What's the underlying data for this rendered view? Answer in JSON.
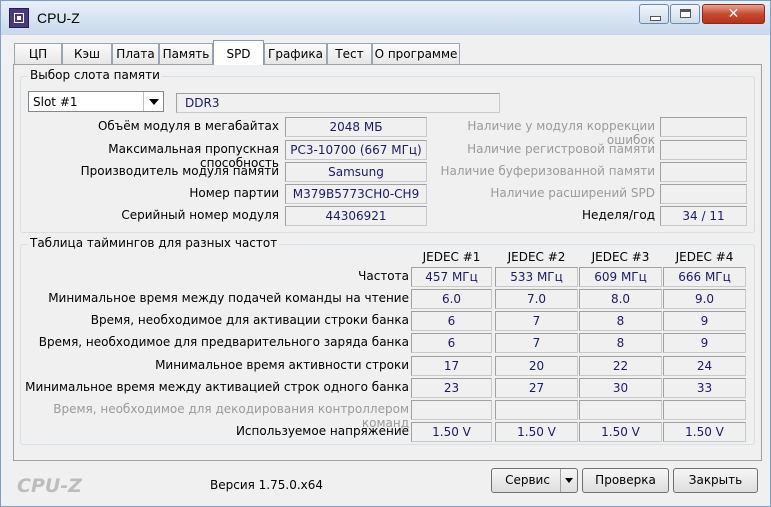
{
  "window": {
    "title": "CPU-Z"
  },
  "tabs": [
    "ЦП",
    "Кэш",
    "Плата",
    "Память",
    "SPD",
    "Графика",
    "Тест",
    "О программе"
  ],
  "active_tab": "SPD",
  "slot_group": {
    "legend": "Выбор слота памяти",
    "slot_selected": "Slot #1",
    "memory_type": "DDR3",
    "rows": [
      {
        "label": "Объём модуля в мегабайтах",
        "value": "2048 МБ"
      },
      {
        "label": "Максимальная пропускная способность",
        "value": "PC3-10700 (667 МГц)"
      },
      {
        "label": "Производитель модуля памяти",
        "value": "Samsung"
      },
      {
        "label": "Номер партии",
        "value": "M379B5773CH0-CH9"
      },
      {
        "label": "Серийный номер модуля",
        "value": "44306921"
      }
    ],
    "right_rows": [
      {
        "label": "Наличие у модуля коррекции ошибок",
        "value": ""
      },
      {
        "label": "Наличие регистровой памяти",
        "value": ""
      },
      {
        "label": "Наличие буферизованной памяти",
        "value": ""
      },
      {
        "label": "Наличие расширений SPD",
        "value": ""
      },
      {
        "label": "Неделя/год",
        "value": "34 / 11"
      }
    ]
  },
  "timing_group": {
    "legend": "Таблица таймингов для разных частот",
    "columns": [
      "JEDEC #1",
      "JEDEC #2",
      "JEDEC #3",
      "JEDEC #4"
    ],
    "rows": [
      {
        "label": "Частота",
        "values": [
          "457 МГц",
          "533 МГц",
          "609 МГц",
          "666 МГц"
        ]
      },
      {
        "label": "Минимальное время между подачей команды на чтение",
        "values": [
          "6.0",
          "7.0",
          "8.0",
          "9.0"
        ]
      },
      {
        "label": "Время, необходимое для активации строки банка",
        "values": [
          "6",
          "7",
          "8",
          "9"
        ]
      },
      {
        "label": "Время, необходимое для предварительного заряда банка",
        "values": [
          "6",
          "7",
          "8",
          "9"
        ]
      },
      {
        "label": "Минимальное время активности строки",
        "values": [
          "17",
          "20",
          "22",
          "24"
        ]
      },
      {
        "label": "Минимальное время между активацией строк одного банка",
        "values": [
          "23",
          "27",
          "30",
          "33"
        ]
      },
      {
        "label": "Время, необходимое для декодирования контроллером команд",
        "values": [
          "",
          "",
          "",
          ""
        ]
      },
      {
        "label": "Используемое напряжение",
        "values": [
          "1.50 V",
          "1.50 V",
          "1.50 V",
          "1.50 V"
        ]
      }
    ]
  },
  "footer": {
    "logo": "CPU-Z",
    "version": "Версия 1.75.0.x64",
    "service_button": "Сервис",
    "validate_button": "Проверка",
    "close_button": "Закрыть"
  }
}
